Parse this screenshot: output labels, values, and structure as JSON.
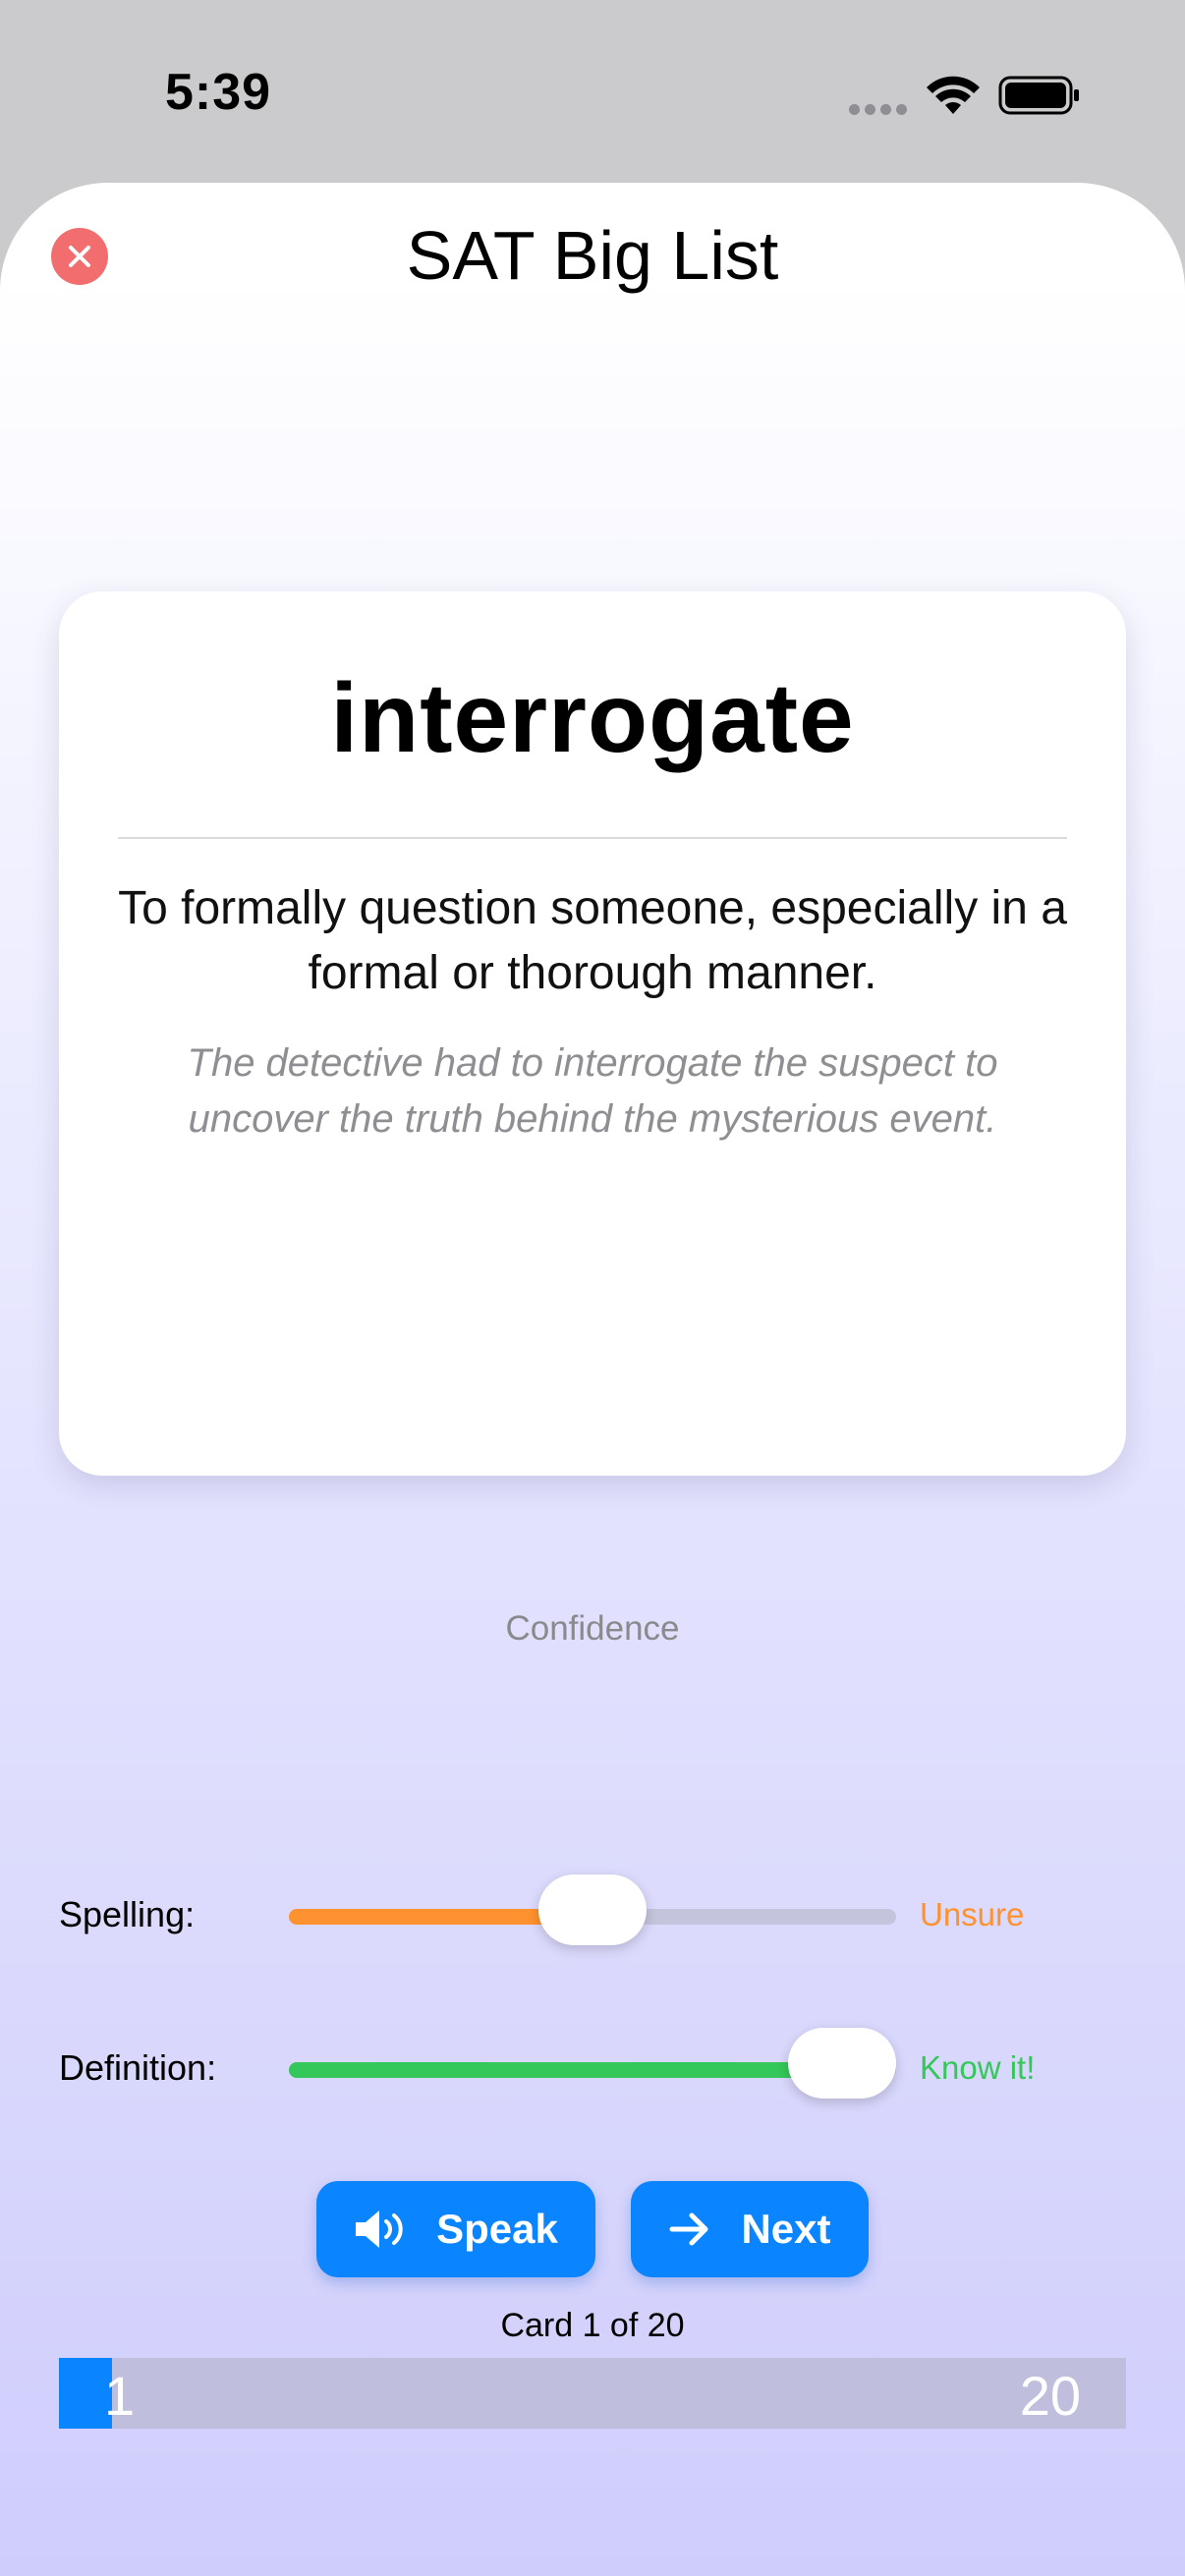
{
  "status_bar": {
    "time": "5:39"
  },
  "header": {
    "title": "SAT Big List"
  },
  "card": {
    "word": "interrogate",
    "definition": "To formally question someone, especially in a formal or thorough manner.",
    "example": "The detective had to interrogate the suspect to uncover the truth behind the mysterious event."
  },
  "confidence": {
    "label": "Confidence",
    "spelling": {
      "label": "Spelling:",
      "status": "Unsure",
      "level": 0.5,
      "color": "#ff9230"
    },
    "definition": {
      "label": "Definition:",
      "status": "Know it!",
      "level": 1.0,
      "color": "#34c759"
    }
  },
  "buttons": {
    "speak_label": "Speak",
    "next_label": "Next"
  },
  "progress": {
    "label": "Card 1 of 20",
    "current": 1,
    "total": 20,
    "start_label": "1",
    "end_label": "20"
  },
  "colors": {
    "accent": "#0a84ff",
    "close": "#f26d6d"
  }
}
